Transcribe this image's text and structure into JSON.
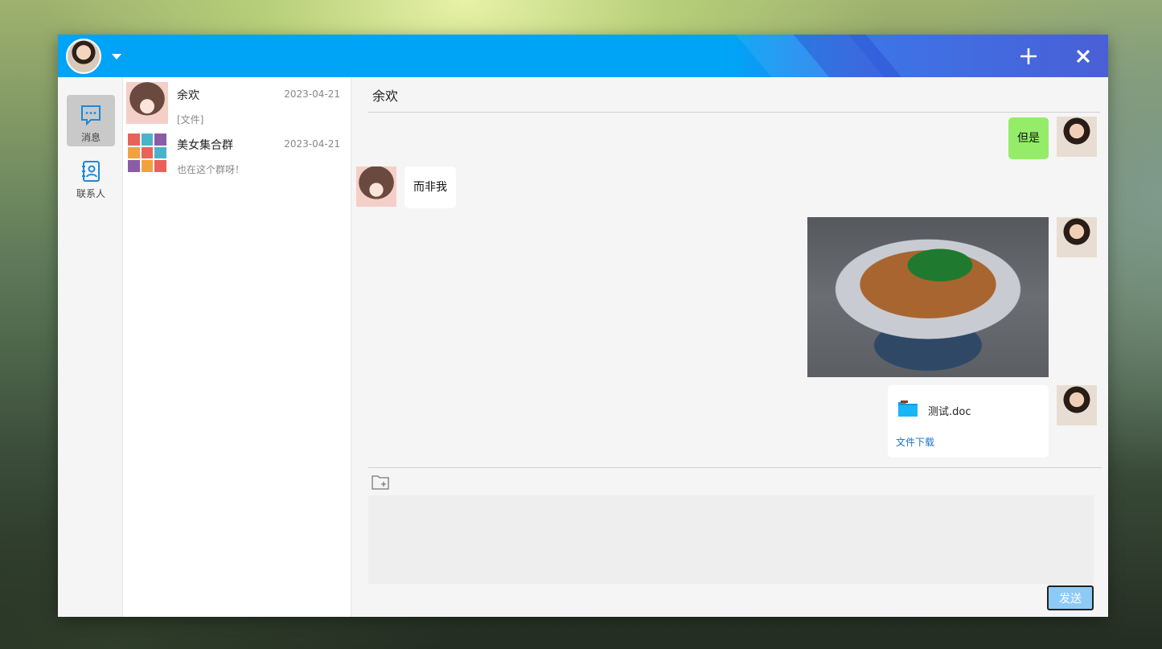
{
  "titlebar": {
    "add_icon": "plus-icon",
    "close_icon": "close-icon"
  },
  "nav": {
    "messages_label": "消息",
    "contacts_label": "联系人"
  },
  "conversations": [
    {
      "name": "余欢",
      "date": "2023-04-21",
      "preview": "[文件]"
    },
    {
      "name": "美女集合群",
      "date": "2023-04-21",
      "preview": "也在这个群呀！"
    }
  ],
  "chat": {
    "title": "余欢",
    "messages": [
      {
        "from": "me",
        "type": "text",
        "text": "但是"
      },
      {
        "from": "other",
        "type": "text",
        "text": "而非我"
      },
      {
        "from": "me",
        "type": "image"
      },
      {
        "from": "me",
        "type": "file",
        "file_name": "测试.doc",
        "download_label": "文件下载"
      }
    ]
  },
  "composer": {
    "input_value": "",
    "send_label": "发送"
  },
  "colors": {
    "titlebar_blue": "#00a4f7",
    "bubble_green": "#95ec69",
    "send_button": "#8fcaf6",
    "link": "#1a73c9"
  }
}
